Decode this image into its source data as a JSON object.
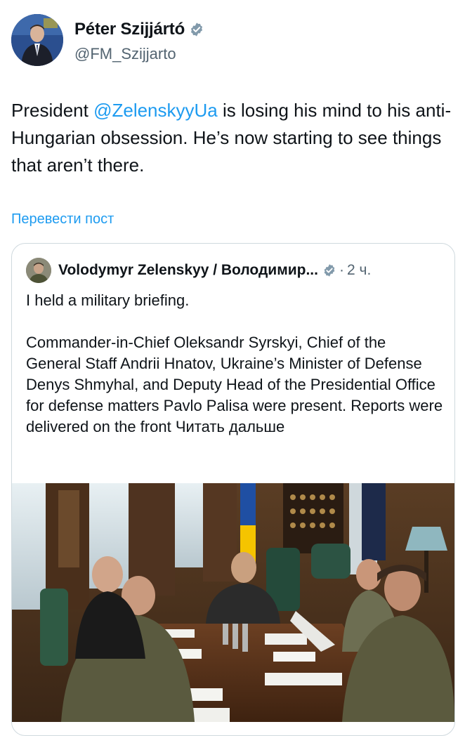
{
  "author": {
    "name": "Péter Szijjártó",
    "handle": "@FM_Szijjarto"
  },
  "post": {
    "text_before": "President ",
    "mention": "@ZelenskyyUa",
    "text_after": " is losing his mind to his anti-Hungarian obsession. He’s now starting to see things that aren’t there."
  },
  "translate_label": "Перевести пост",
  "quoted": {
    "name": "Volodymyr Zelenskyy / Володимир...",
    "dot": "·",
    "time": "2 ч.",
    "paragraph1": "I held a military briefing.",
    "paragraph2": "Commander-in-Chief Oleksandr Syrskyi, Chief of the General Staff Andrii Hnatov, Ukraine’s Minister of Defense Denys Shmyhal, and Deputy Head of the Presidential Office for defense matters Pavlo Palisa were present. Reports were delivered on the front ",
    "read_more": "Читать дальше"
  },
  "colors": {
    "accent": "#1d9bf0",
    "secondary_text": "#536471",
    "border": "#cfd9de"
  },
  "icons": {
    "verified": "verified-badge-icon"
  }
}
